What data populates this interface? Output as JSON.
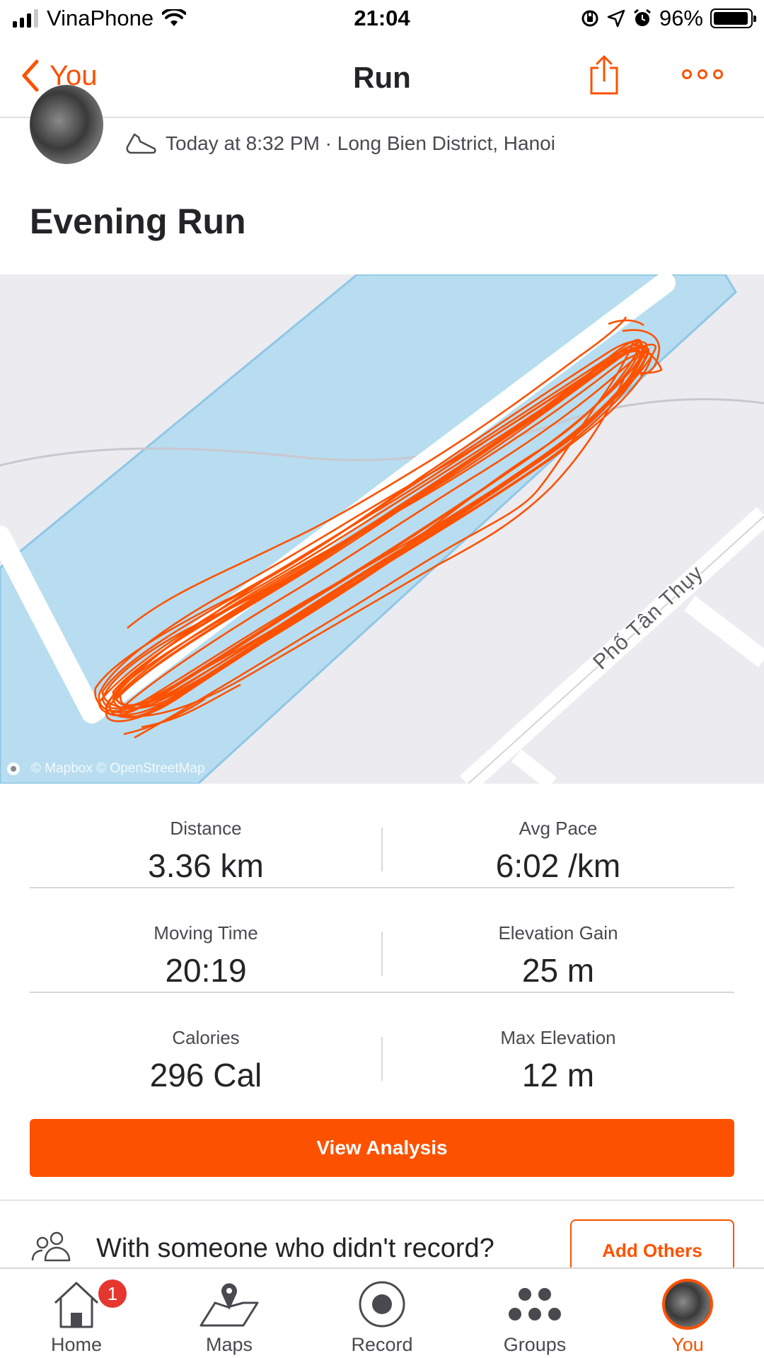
{
  "status_bar": {
    "carrier": "VinaPhone",
    "time": "21:04",
    "battery_percent": "96%",
    "battery_level": 0.96,
    "icons": [
      "signal-icon",
      "wifi-icon",
      "orientation-lock-icon",
      "location-icon",
      "alarm-icon",
      "battery-icon"
    ]
  },
  "nav": {
    "back_label": "You",
    "title": "Run",
    "share_icon": "share-icon",
    "more_icon": "more-icon"
  },
  "activity": {
    "meta": "Today at 8:32 PM · Long Bien District, Hanoi",
    "title": "Evening Run",
    "activity_icon": "shoe-icon"
  },
  "map": {
    "street_label": "Phố Tân Thụy",
    "attribution": "© Mapbox © OpenStreetMap",
    "route_color": "#fc5200",
    "water_color": "#b8ddf0"
  },
  "stats": [
    [
      {
        "label": "Distance",
        "value": "3.36 km"
      },
      {
        "label": "Avg Pace",
        "value": "6:02 /km"
      }
    ],
    [
      {
        "label": "Moving Time",
        "value": "20:19"
      },
      {
        "label": "Elevation Gain",
        "value": "25 m"
      }
    ],
    [
      {
        "label": "Calories",
        "value": "296 Cal"
      },
      {
        "label": "Max Elevation",
        "value": "12 m"
      }
    ]
  ],
  "actions": {
    "view_analysis": "View Analysis",
    "others_prompt": "With someone who didn't record?",
    "add_others": "Add Others"
  },
  "tabs": [
    {
      "label": "Home",
      "icon": "home-icon",
      "badge": "1"
    },
    {
      "label": "Maps",
      "icon": "maps-icon"
    },
    {
      "label": "Record",
      "icon": "record-icon"
    },
    {
      "label": "Groups",
      "icon": "groups-icon"
    },
    {
      "label": "You",
      "icon": "avatar",
      "active": true
    }
  ],
  "colors": {
    "brand": "#fc5200",
    "text": "#242428",
    "badge": "#e5362f"
  }
}
